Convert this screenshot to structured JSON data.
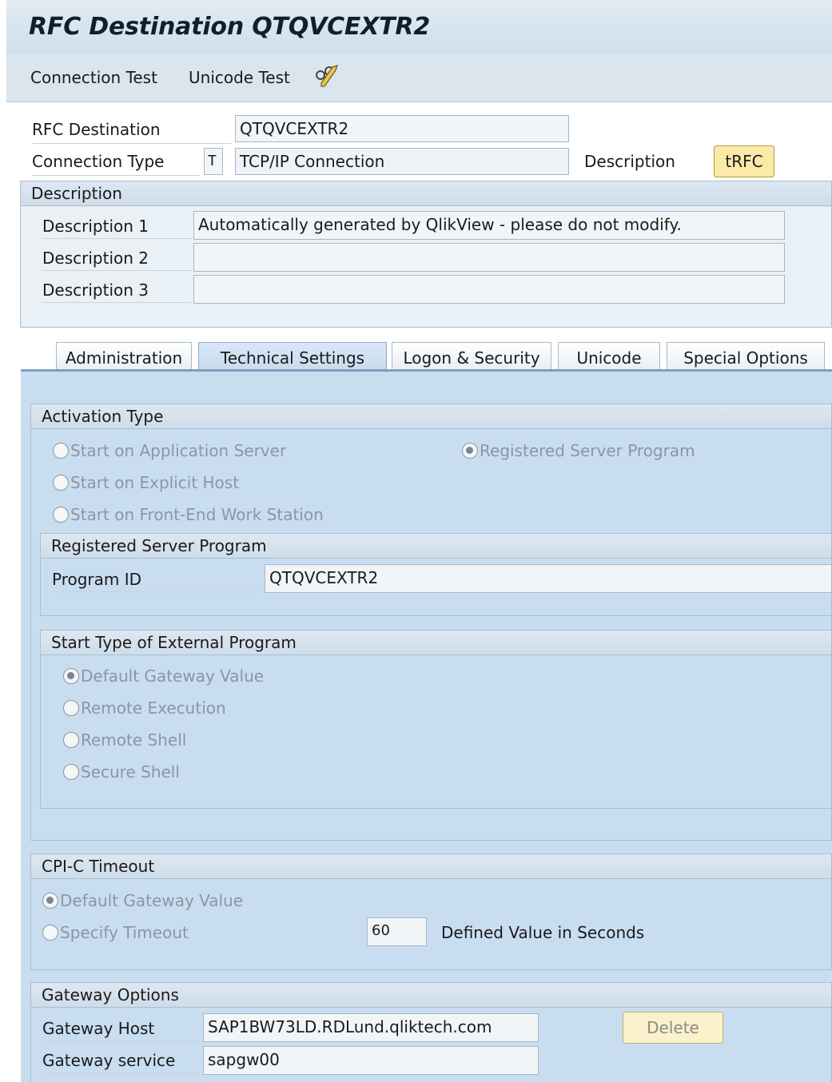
{
  "title": "RFC Destination QTQVCEXTR2",
  "toolbar": {
    "connection_test": "Connection Test",
    "unicode_test": "Unicode Test",
    "extra_icon": "pencil-glasses-icon"
  },
  "header": {
    "rfc_destination_label": "RFC Destination",
    "rfc_destination_value": "QTQVCEXTR2",
    "connection_type_label": "Connection Type",
    "connection_type_code": "T",
    "connection_type_value": "TCP/IP Connection",
    "description_label": "Description",
    "trfc_button": "tRFC"
  },
  "description": {
    "title": "Description",
    "d1_label": "Description 1",
    "d1_value": "Automatically generated by QlikView - please do not modify.",
    "d2_label": "Description 2",
    "d2_value": "",
    "d3_label": "Description 3",
    "d3_value": ""
  },
  "tabs": {
    "administration": "Administration",
    "technical_settings": "Technical Settings",
    "logon_security": "Logon & Security",
    "unicode": "Unicode",
    "special_options": "Special Options",
    "active": "Technical Settings"
  },
  "activation": {
    "title": "Activation Type",
    "opt_app_server": "Start on Application Server",
    "opt_explicit_host": "Start on Explicit Host",
    "opt_frontend": "Start on Front-End Work Station",
    "opt_registered": "Registered Server Program",
    "selected": "Registered Server Program"
  },
  "registered": {
    "title": "Registered Server Program",
    "program_id_label": "Program ID",
    "program_id_value": "QTQVCEXTR2"
  },
  "start_type": {
    "title": "Start Type of External Program",
    "opt_default": "Default Gateway Value",
    "opt_remote_exec": "Remote Execution",
    "opt_remote_shell": "Remote Shell",
    "opt_secure_shell": "Secure Shell",
    "selected": "Default Gateway Value"
  },
  "cpic": {
    "title": "CPI-C Timeout",
    "opt_default": "Default Gateway Value",
    "opt_specify": "Specify Timeout",
    "timeout_value": "60",
    "timeout_unit_label": "Defined Value in Seconds",
    "selected": "Default Gateway Value"
  },
  "gateway": {
    "title": "Gateway Options",
    "host_label": "Gateway Host",
    "host_value": "SAP1BW73LD.RDLund.qliktech.com",
    "service_label": "Gateway service",
    "service_value": "sapgw00",
    "delete_button": "Delete"
  }
}
